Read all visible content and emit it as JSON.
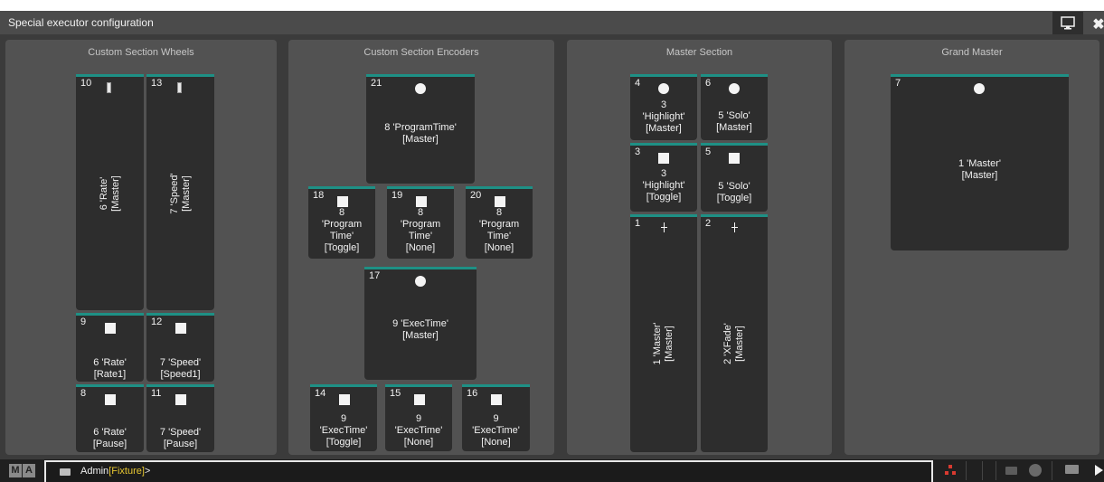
{
  "window": {
    "title": "Special executor configuration",
    "close_glyph": "✖"
  },
  "sections": [
    {
      "title": "Custom Section Wheels",
      "tiles": [
        {
          "num": "10",
          "icon": "slider-icon",
          "label": "6 'Rate'\n[Master]",
          "vertical": true
        },
        {
          "num": "13",
          "icon": "slider-icon",
          "label": "7 'Speed'\n[Master]",
          "vertical": true
        },
        {
          "num": "9",
          "icon": "square-icon",
          "label": "6 'Rate'\n[Rate1]"
        },
        {
          "num": "12",
          "icon": "square-icon",
          "label": "7 'Speed'\n[Speed1]"
        },
        {
          "num": "8",
          "icon": "square-icon",
          "label": "6 'Rate'\n[Pause]"
        },
        {
          "num": "11",
          "icon": "square-icon",
          "label": "7 'Speed'\n[Pause]"
        }
      ]
    },
    {
      "title": "Custom Section Encoders",
      "tiles": [
        {
          "num": "21",
          "icon": "circle-icon",
          "label": "8 'ProgramTime'\n[Master]"
        },
        {
          "num": "18",
          "icon": "square-icon",
          "label": "8\n'Program\nTime'\n[Toggle]"
        },
        {
          "num": "19",
          "icon": "square-icon",
          "label": "8\n'Program\nTime'\n[None]"
        },
        {
          "num": "20",
          "icon": "square-icon",
          "label": "8\n'Program\nTime'\n[None]"
        },
        {
          "num": "17",
          "icon": "circle-icon",
          "label": "9 'ExecTime'\n[Master]"
        },
        {
          "num": "14",
          "icon": "square-icon",
          "label": "9\n'ExecTime'\n[Toggle]"
        },
        {
          "num": "15",
          "icon": "square-icon",
          "label": "9\n'ExecTime'\n[None]"
        },
        {
          "num": "16",
          "icon": "square-icon",
          "label": "9\n'ExecTime'\n[None]"
        }
      ]
    },
    {
      "title": "Master Section",
      "tiles": [
        {
          "num": "4",
          "icon": "circle-icon",
          "label": "3\n'Highlight'\n[Master]"
        },
        {
          "num": "6",
          "icon": "circle-icon",
          "label": "5 'Solo'\n[Master]"
        },
        {
          "num": "3",
          "icon": "square-icon",
          "label": "3\n'Highlight'\n[Toggle]"
        },
        {
          "num": "5",
          "icon": "square-icon",
          "label": "5 'Solo'\n[Toggle]"
        },
        {
          "num": "1",
          "icon": "fader-icon",
          "label": "1 'Master'\n[Master]",
          "vertical": true
        },
        {
          "num": "2",
          "icon": "fader-icon",
          "label": "2 'XFade'\n[Master]",
          "vertical": true
        }
      ]
    },
    {
      "title": "Grand Master",
      "tiles": [
        {
          "num": "7",
          "icon": "circle-icon",
          "label": "1 'Master'\n[Master]"
        }
      ]
    }
  ],
  "command_line": {
    "logo": [
      "M",
      "A"
    ],
    "user": "Admin",
    "context": "[Fixture]",
    "prompt_end": ">"
  },
  "colors": {
    "accent": "#1e9085",
    "context_text": "#e6c631",
    "network_icon": "#d93a30"
  }
}
